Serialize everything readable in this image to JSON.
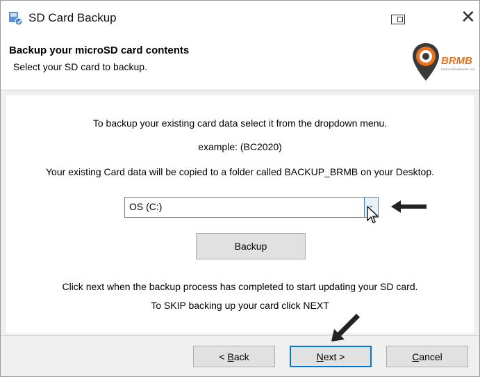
{
  "window": {
    "title": "SD Card Backup"
  },
  "header": {
    "title": "Backup your microSD card contents",
    "subtitle": "Select your SD card to backup.",
    "logo_text": "BRMB",
    "logo_url_text": "backroadmapbooks.com"
  },
  "content": {
    "instruction1": "To backup your existing card data select it from the dropdown menu.",
    "example": "example: (BC2020)",
    "instruction2": "Your existing Card data will be copied to a folder called BACKUP_BRMB on your Desktop.",
    "drive_select": {
      "value": "OS (C:)"
    },
    "backup_label": "Backup",
    "instruction3": "Click next when the backup process has completed to start updating your SD card.",
    "instruction4": "To SKIP backing up your card click NEXT"
  },
  "footer": {
    "back_mnemonic": "B",
    "back_rest": "ack",
    "back_prefix": "< ",
    "next_mnemonic": "N",
    "next_rest": "ext >",
    "cancel_mnemonic": "C",
    "cancel_rest": "ancel"
  },
  "colors": {
    "accent": "#0078d7",
    "logo_orange": "#e8731c",
    "logo_dark": "#3a3a3a"
  },
  "icons": [
    "app-icon",
    "mode-icon",
    "close-icon",
    "chevron-down-icon",
    "cursor-icon",
    "arrow-left-icon",
    "arrow-down-left-icon"
  ]
}
